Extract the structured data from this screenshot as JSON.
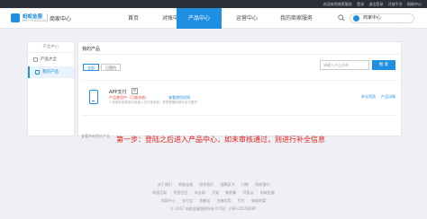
{
  "topbar": {
    "links": [
      "欢迎来到商家服务",
      "登录",
      "退出登录",
      "开放平台",
      "蚂蚁中心"
    ]
  },
  "logo": {
    "brand": "蚂蚁金服",
    "sub": "ANT FINANCIAL",
    "center": "商家中心"
  },
  "nav": {
    "items": [
      "首页",
      "对账中心",
      "产品中心",
      "运营中心",
      "我的商家服务"
    ],
    "active_index": 2
  },
  "header_right": {
    "merchant_label": "商家中心"
  },
  "sidebar": {
    "title": "产品中心",
    "items": [
      {
        "label": "产品大全"
      },
      {
        "label": "我的产品"
      }
    ],
    "active_index": 1
  },
  "main": {
    "title": "我的产品",
    "tabs": [
      "全部",
      "已签约"
    ],
    "search_placeholder": "请输入产品名称",
    "search_button": "搜 索",
    "product": {
      "name": "APP支付",
      "badge": "签",
      "status": "产品使用中（已被冻结）",
      "status_link": "查看使用须知",
      "desc": "1.快速安装商家应用接入支付宝收款，享受便捷的移动支付服务",
      "action_1": "补全资质",
      "action_2": "产品详情"
    },
    "note": "查看所有签约产品"
  },
  "annotation": "第一步：登陆之后进入产品中心，如未审核通过，则进行补全信息",
  "footer": {
    "row1": [
      "关于我们",
      "蚂蚁金服",
      "联系我们",
      "诚聘英才",
      "口碑",
      "网商银行"
    ],
    "row2": [
      "网银互联",
      "阿里巴巴",
      "淘宝网",
      "天猫",
      "聚划算",
      "阿里云",
      "蚂蚁金服"
    ],
    "row3": [
      "网国中心",
      "支付宝",
      "余额宝",
      "芝麻信用",
      "钉钉",
      "蚂蚁财富"
    ],
    "copyright": "© 2017 蚂蚁金服版权所有 ICP证：沪B2-20150087"
  }
}
